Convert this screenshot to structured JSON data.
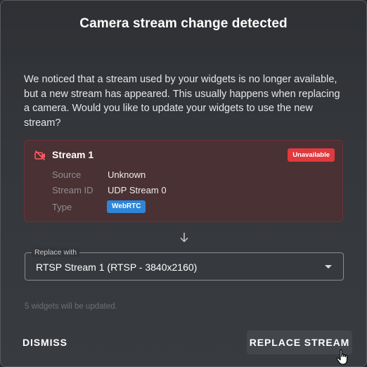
{
  "dialog": {
    "title": "Camera stream change detected",
    "description": "We noticed that a stream used by your widgets is no longer available, but a new stream has appeared. This usually happens when replacing a camera. Would you like to update your widgets to use the new stream?"
  },
  "stream_card": {
    "icon": "camera-off-icon",
    "title": "Stream 1",
    "status_badge": "Unavailable",
    "rows": [
      {
        "label": "Source",
        "value": "Unknown"
      },
      {
        "label": "Stream ID",
        "value": "UDP Stream 0"
      },
      {
        "label": "Type",
        "value": "WebRTC"
      }
    ]
  },
  "arrow_icon": "arrow-down-icon",
  "replace_select": {
    "legend": "Replace with",
    "value": "RTSP Stream 1 (RTSP - 3840x2160)",
    "caret_icon": "caret-down-icon"
  },
  "helper_text": "5 widgets will be updated.",
  "actions": {
    "dismiss_label": "DISMISS",
    "replace_label": "REPLACE STREAM"
  },
  "colors": {
    "unavailable": "#e03a3f",
    "type_badge": "#2d86d9",
    "card_background": "#4a3134",
    "card_border": "#6a3337"
  }
}
